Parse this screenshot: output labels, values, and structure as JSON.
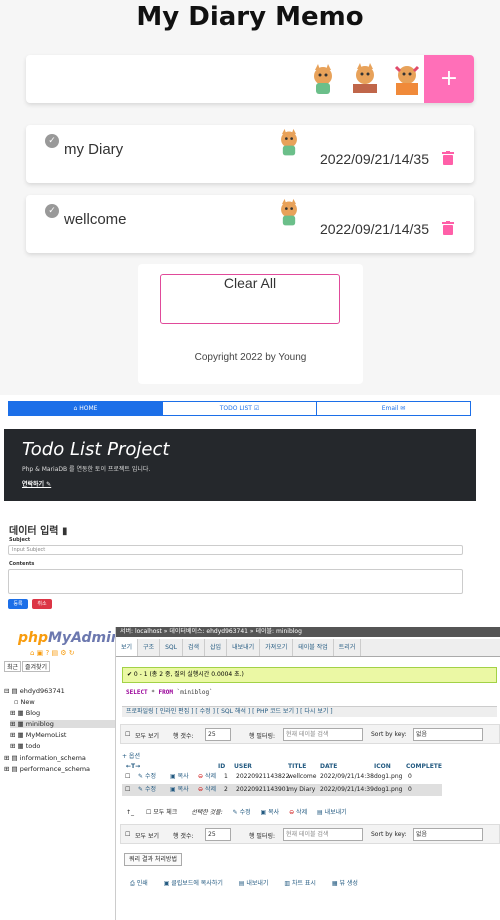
{
  "diary": {
    "title": "My Diary Memo",
    "add_label": "+",
    "memos": [
      {
        "text": "my Diary",
        "date": "2022/09/21/14/35"
      },
      {
        "text": "wellcome",
        "date": "2022/09/21/14/35"
      }
    ],
    "clear_label": "Clear All",
    "copyright": "Copyright 2022 by Young",
    "accent": "#ff6fb8"
  },
  "todo": {
    "tabs": [
      "⌂ HOME",
      "TODO LIST ☑",
      "Email ✉"
    ],
    "hero_title": "Todo List Project",
    "hero_sub": "Php & MariaDB 를 연동한 토이 프로젝트 입니다.",
    "hero_link": "연락하기 ✎",
    "form_title": "데이터 입력 ▮",
    "subject_label": "Subject",
    "subject_placeholder": "Input Subject",
    "contents_label": "Contents",
    "submit_label": "등록",
    "cancel_label": "취소"
  },
  "pma": {
    "logo_a": "php",
    "logo_b": "MyAdmin",
    "recent": "최근",
    "favorites": "즐겨찾기",
    "tree": [
      "ehdyd963741",
      "New",
      "Blog",
      "miniblog",
      "MyMemoList",
      "todo",
      "information_schema",
      "performance_schema"
    ],
    "breadcrumb": "서버: localhost » 데이터베이스: ehdyd963741 » 테이블: miniblog",
    "toolbar": [
      "보기",
      "구조",
      "SQL",
      "검색",
      "삽입",
      "내보내기",
      "가져오기",
      "테이블 작업",
      "트리거"
    ],
    "success": "✔ 0 - 1 (총 2 중, 질의 실행시간 0.0004 초.)",
    "sql_kw1": "SELECT",
    "sql_mid": " * ",
    "sql_kw2": "FROM",
    "sql_table": " `miniblog`",
    "links": "프로파일링 [ 인라인 편집 ] [ 수정 ] [ SQL 해석 ] [ PHP 코드 보기 ] [ 다시 보기 ]",
    "show_all": "모두 보기",
    "rows_label": "행 갯수:",
    "rows_value": "25",
    "filter_label": "행 필터링:",
    "filter_placeholder": "현재 테이블 검색",
    "sortby_label": "Sort by key:",
    "sortby_value": "없음",
    "options": "+ 옵션",
    "columns": [
      "ID",
      "USER",
      "TITLE",
      "DATE",
      "ICON",
      "COMPLETE"
    ],
    "rows": [
      {
        "id": "1",
        "user": "20220921143822",
        "title": "wellcome",
        "date": "2022/09/21/14:38",
        "icon": "dog1.png",
        "complete": "0"
      },
      {
        "id": "2",
        "user": "20220921143901",
        "title": "my Diary",
        "date": "2022/09/21/14:39",
        "icon": "dog1.png",
        "complete": "0"
      }
    ],
    "row_edit": "수정",
    "row_copy": "복사",
    "row_delete": "삭제",
    "check_all": "모두 체크",
    "selected": "선택한 것을:",
    "query_ops": "쿼리 결과 처리방법",
    "op_print": "인쇄",
    "op_clip": "클립보드에 복사하기",
    "op_export": "내보내기",
    "op_chart": "차트 표시",
    "op_view": "뷰 생성"
  }
}
